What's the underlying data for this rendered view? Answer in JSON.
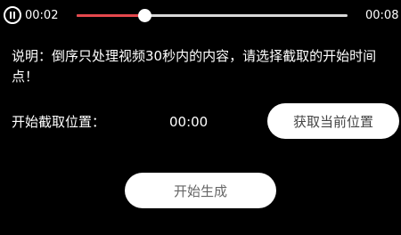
{
  "player": {
    "current_time": "00:02",
    "total_time": "00:08",
    "progress": 0.25,
    "played_color": "#e5484d",
    "track_color": "#d8d8d8",
    "pause_icon": "pause-circle-icon"
  },
  "notice": {
    "text": "说明：倒序只处理视频30秒内的内容，请选择截取的开始时间点！"
  },
  "start_position": {
    "label": "开始截取位置：",
    "value": "00:00",
    "get_current_label": "获取当前位置"
  },
  "actions": {
    "start_label": "开始生成"
  }
}
